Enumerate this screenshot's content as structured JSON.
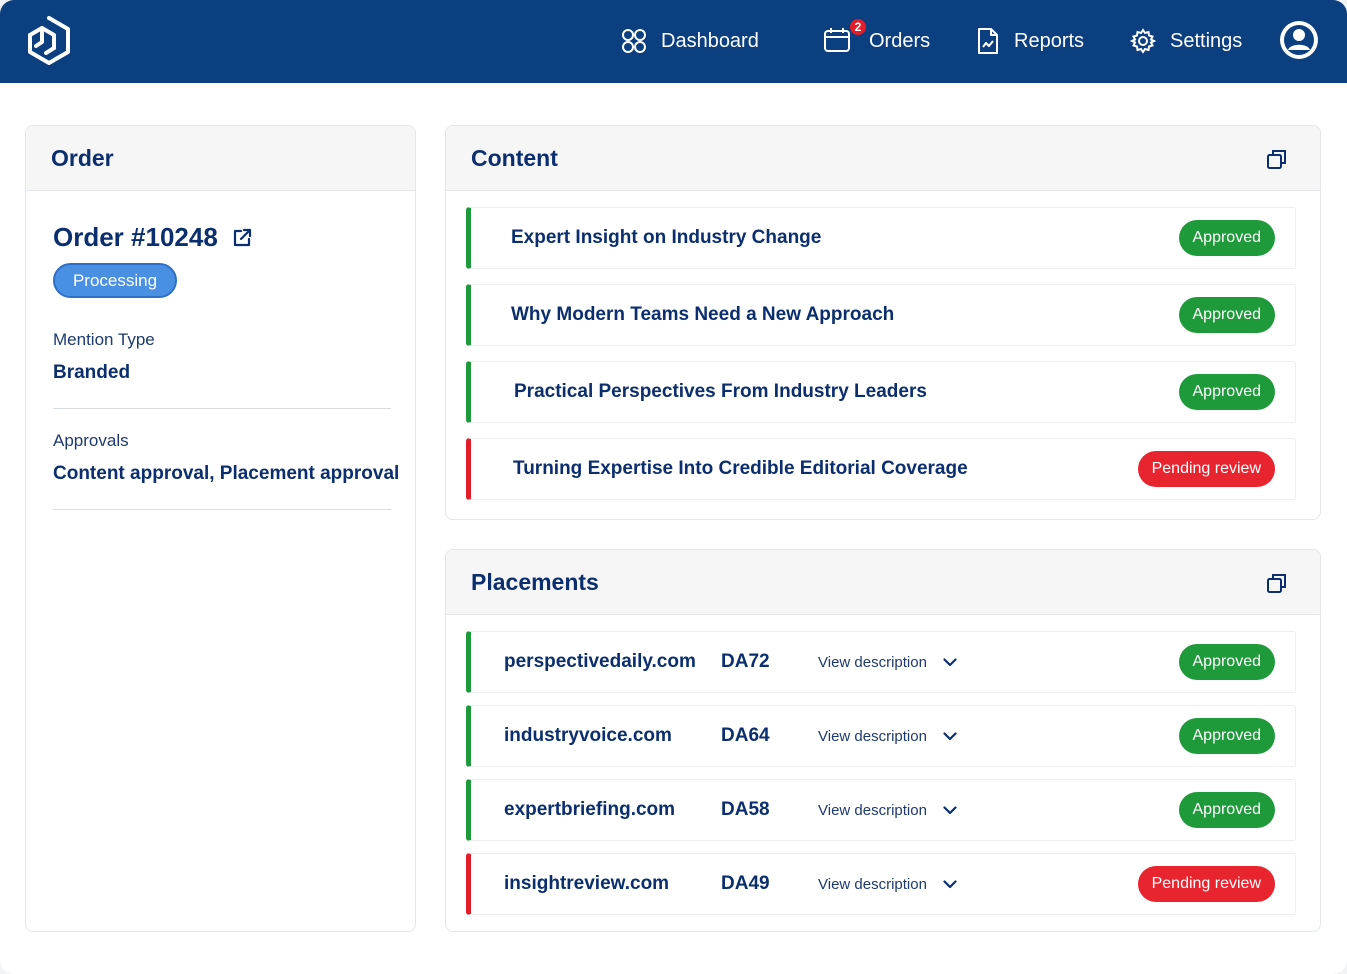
{
  "nav": {
    "items": [
      {
        "label": "Dashboard",
        "icon": "dashboard-grid-icon"
      },
      {
        "label": "Orders",
        "icon": "calendar-icon",
        "badge": "2"
      },
      {
        "label": "Reports",
        "icon": "report-document-icon"
      },
      {
        "label": "Settings",
        "icon": "gear-icon"
      }
    ],
    "avatar_icon": "user-avatar-icon"
  },
  "order_card": {
    "header": "Order",
    "order_title": "Order #10248",
    "status": "Processing",
    "mention_type_label": "Mention Type",
    "mention_type_value": "Branded",
    "approvals_label": "Approvals",
    "approvals_value": "Content approval, Placement approval"
  },
  "content_card": {
    "header": "Content",
    "items": [
      {
        "title": "Expert Insight on Industry Change",
        "status": "Approved"
      },
      {
        "title": "Why Modern Teams Need a New Approach",
        "status": "Approved"
      },
      {
        "title": "Practical Perspectives From Industry Leaders",
        "status": "Approved"
      },
      {
        "title": "Turning Expertise Into Credible Editorial Coverage",
        "status": "Pending review"
      }
    ]
  },
  "placements_card": {
    "header": "Placements",
    "view_label": "View description",
    "items": [
      {
        "domain": "perspectivedaily.com",
        "da": "DA72",
        "status": "Approved"
      },
      {
        "domain": "industryvoice.com",
        "da": "DA64",
        "status": "Approved"
      },
      {
        "domain": "expertbriefing.com",
        "da": "DA58",
        "status": "Approved"
      },
      {
        "domain": "insightreview.com",
        "da": "DA49",
        "status": "Pending review"
      }
    ]
  },
  "colors": {
    "topbar": "#0b3f80",
    "approved": "#1f9a3a",
    "pending": "#e8242f",
    "processing": "#4a90e2",
    "heading_text": "#0b2f6e"
  }
}
